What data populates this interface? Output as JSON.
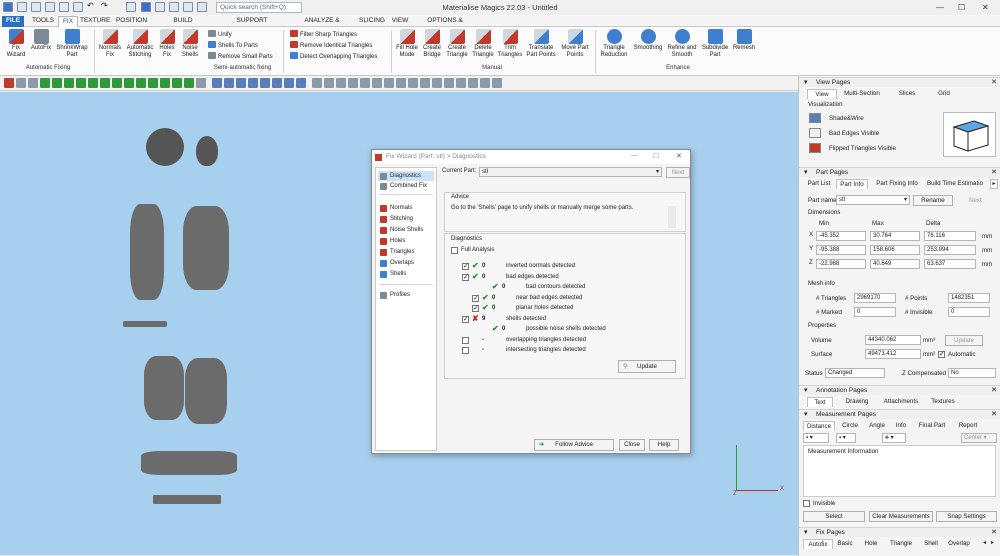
{
  "app": {
    "title": "Materialise Magics 22.03 - Untitled",
    "search_placeholder": "Quick search (Shift+Q)"
  },
  "menu": {
    "tabs": [
      "FILE",
      "TOOLS",
      "FIX",
      "TEXTURE",
      "POSITION",
      "BUILD PREPARATION",
      "SUPPORT GENERATION",
      "ANALYZE & REPORT",
      "SLICING",
      "VIEW",
      "OPTIONS & HELP"
    ],
    "active": "FIX"
  },
  "ribbon": {
    "buttons": [
      {
        "label1": "Fix",
        "label2": "Wizard",
        "icon": "fix-wizard-icon"
      },
      {
        "label1": "AutoFix",
        "label2": "",
        "icon": "autofix-icon"
      },
      {
        "label1": "ShrinkWrap",
        "label2": "Part",
        "icon": "shrinkwrap-icon"
      },
      {
        "label1": "Normals",
        "label2": "Fix",
        "icon": "normals-fix-icon"
      },
      {
        "label1": "Automatic",
        "label2": "Stitching",
        "icon": "stitching-icon"
      },
      {
        "label1": "Holes",
        "label2": "Fix",
        "icon": "holes-fix-icon"
      },
      {
        "label1": "Noise",
        "label2": "Shells",
        "icon": "noise-shells-icon"
      },
      {
        "label1": "Fill Hole",
        "label2": "Mode",
        "icon": "fill-hole-icon"
      },
      {
        "label1": "Create",
        "label2": "Bridge",
        "icon": "bridge-icon"
      },
      {
        "label1": "Create",
        "label2": "Triangle",
        "icon": "create-triangle-icon"
      },
      {
        "label1": "Delete",
        "label2": "Triangle",
        "icon": "delete-triangle-icon"
      },
      {
        "label1": "Trim",
        "label2": "Triangles",
        "icon": "trim-icon"
      },
      {
        "label1": "Translate",
        "label2": "Part Points",
        "icon": "translate-points-icon"
      },
      {
        "label1": "Move Part",
        "label2": "Points",
        "icon": "move-points-icon"
      },
      {
        "label1": "Triangle",
        "label2": "Reduction",
        "icon": "triangle-reduction-icon"
      },
      {
        "label1": "Smoothing",
        "label2": "",
        "icon": "smoothing-icon"
      },
      {
        "label1": "Refine and",
        "label2": "Smooth",
        "icon": "refine-smooth-icon"
      },
      {
        "label1": "Subdivide",
        "label2": "Part",
        "icon": "subdivide-icon"
      },
      {
        "label1": "Remesh",
        "label2": "",
        "icon": "remesh-icon"
      }
    ],
    "small": [
      "Unify",
      "Shells To Parts",
      "Remove Small Parts",
      "Filter Sharp Triangles",
      "Remove Identical Triangles",
      "Detect Overlapping Triangles"
    ],
    "groups": [
      "Automatic Fixing",
      "Semi-automatic fixing",
      "Manual",
      "Enhance"
    ],
    "colors": {
      "blue": "#3f7fd0",
      "red": "#c0392b",
      "gray": "#7c8a96",
      "green": "#2e9a3a"
    }
  },
  "view_pages": {
    "title": "View Pages",
    "tabs": [
      "View",
      "Multi-Section",
      "Slices",
      "Grid"
    ],
    "section": "Visualization",
    "options": [
      "Shade&Wire",
      "Bad Edges Visible",
      "Flipped Triangles Visible"
    ]
  },
  "part_pages": {
    "title": "Part Pages",
    "tabs": [
      "Part List",
      "Part Info",
      "Part Fixing Info",
      "Build Time Estimatio"
    ],
    "part_name_label": "Part name",
    "part_name": "stl",
    "rename": "Rename",
    "next": "Next",
    "dimensions": "Dimensions",
    "cols": [
      "Min",
      "Max",
      "Delta"
    ],
    "rows": [
      {
        "axis": "X",
        "min": "-45.352",
        "max": "30.764",
        "delta": "76.116",
        "unit": "mm"
      },
      {
        "axis": "Y",
        "min": "-95.388",
        "max": "158.606",
        "delta": "253.994",
        "unit": "mm"
      },
      {
        "axis": "Z",
        "min": "-22.988",
        "max": "40.649",
        "delta": "63.637",
        "unit": "mm"
      }
    ],
    "mesh_info": "Mesh info",
    "triangles_label": "# Triangles",
    "triangles": "2969170",
    "points_label": "# Points",
    "points": "1482351",
    "marked_label": "# Marked",
    "marked": "0",
    "invisible_label": "# Invisible",
    "invisible": "0",
    "properties": "Properties",
    "volume_label": "Volume",
    "volume": "44340.062",
    "volume_unit": "mm³",
    "update": "Update",
    "surface_label": "Surface",
    "surface": "49473.412",
    "surface_unit": "mm²",
    "automatic": "Automatic",
    "status_label": "Status",
    "status": "Changed",
    "zcomp_label": "Z Compensated",
    "zcomp": "No"
  },
  "annotation_pages": {
    "title": "Annotation Pages",
    "tabs": [
      "Text",
      "Drawing",
      "Attachments",
      "Textures"
    ]
  },
  "measurement_pages": {
    "title": "Measurement Pages",
    "tabs": [
      "Distance",
      "Circle",
      "Angle",
      "Info",
      "Final Part",
      "Report"
    ],
    "center": "Center",
    "info": "Measurement Information",
    "invisible": "Invisible",
    "buttons": [
      "Select",
      "Clear Measurements",
      "Snap Settings"
    ]
  },
  "fix_pages": {
    "title": "Fix Pages",
    "tabs": [
      "Autofix",
      "Basic",
      "Hole",
      "Triangle",
      "Shell",
      "Overlap"
    ]
  },
  "dialog": {
    "title": "Fix Wizard (Part: stl) > Diagnostics",
    "nav": [
      "Diagnostics",
      "Combined Fix",
      "Normals",
      "Stitching",
      "Noise Shells",
      "Holes",
      "Triangles",
      "Overlaps",
      "Shells",
      "Profiles"
    ],
    "current_part_label": "Current Part:",
    "current_part": "stl",
    "next": "Next",
    "advice_label": "Advice",
    "advice": "Go to the 'Shells' page to unify shells or manually merge some parts.",
    "diagnostics_label": "Diagnostics",
    "full_analysis": "Full Analysis",
    "items": [
      {
        "label": "inverted normals detected",
        "count": "0",
        "mark": "ok",
        "checked": true,
        "indent": 0
      },
      {
        "label": "bad edges detected",
        "count": "0",
        "mark": "ok",
        "checked": true,
        "indent": 0
      },
      {
        "label": "bad contours detected",
        "count": "0",
        "mark": "ok",
        "checked": false,
        "indent": 2
      },
      {
        "label": "near bad edges detected",
        "count": "0",
        "mark": "ok",
        "checked": true,
        "indent": 1
      },
      {
        "label": "planar holes detected",
        "count": "0",
        "mark": "ok",
        "checked": true,
        "indent": 1
      },
      {
        "label": "shells detected",
        "count": "9",
        "mark": "bad",
        "checked": true,
        "indent": 0
      },
      {
        "label": "possible noise shells detected",
        "count": "0",
        "mark": "ok",
        "checked": false,
        "indent": 2
      },
      {
        "label": "overlapping triangles detected",
        "count": "-",
        "mark": "none",
        "checked": false,
        "indent": 0
      },
      {
        "label": "intersecting triangles detected",
        "count": "-",
        "mark": "none",
        "checked": false,
        "indent": 0
      }
    ],
    "update": "Update",
    "follow_advice": "Follow Advice",
    "close": "Close",
    "help": "Help"
  },
  "axis": {
    "z": "Z",
    "x": "X"
  }
}
